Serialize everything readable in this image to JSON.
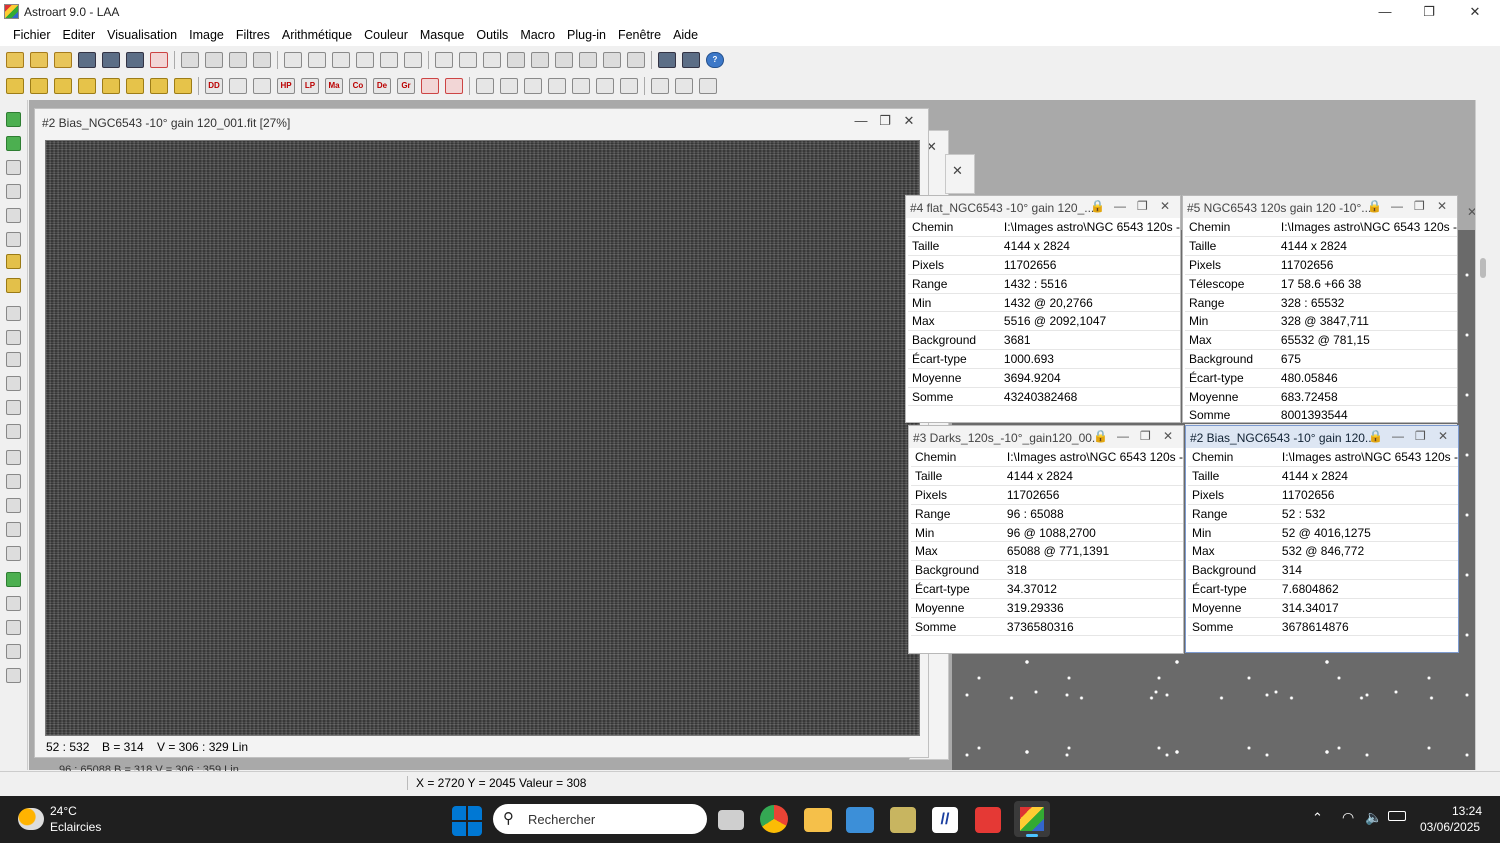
{
  "app": {
    "title": "Astroart 9.0 - LAA"
  },
  "window_controls": {
    "minimize": "—",
    "maximize": "❐",
    "close": "✕"
  },
  "menu": [
    "Fichier",
    "Editer",
    "Visualisation",
    "Image",
    "Filtres",
    "Arithmétique",
    "Couleur",
    "Masque",
    "Outils",
    "Macro",
    "Plug-in",
    "Fenêtre",
    "Aide"
  ],
  "toolbar2_labels": {
    "dd": "DD",
    "hp": "HP",
    "lp": "LP",
    "ma": "Ma",
    "co": "Co",
    "de": "De",
    "gr": "Gr"
  },
  "image_window": {
    "title": "#2 Bias_NGC6543 -10° gain 120_001.fit  [27%]",
    "status_range": "52 : 532",
    "status_b": "B = 314",
    "status_v": "V = 306 : 329 Lin"
  },
  "underlying_status": "96 : 65088     B = 318     V = 306 : 359 Lin",
  "info_windows": [
    {
      "title": "#4 flat_NGC6543 -10° gain 120_...",
      "rows": [
        [
          "Chemin",
          "I:\\Images astro\\NGC 6543 120s -"
        ],
        [
          "Taille",
          "4144 x 2824"
        ],
        [
          "Pixels",
          "11702656"
        ],
        [
          "Range",
          "1432 : 5516"
        ],
        [
          "Min",
          "1432 @ 20,2766"
        ],
        [
          "Max",
          "5516 @ 2092,1047"
        ],
        [
          "Background",
          "3681"
        ],
        [
          "Écart-type",
          "1000.693"
        ],
        [
          "Moyenne",
          "3694.9204"
        ],
        [
          "Somme",
          "43240382468"
        ]
      ]
    },
    {
      "title": "#5 NGC6543 120s gain 120 -10°...",
      "rows": [
        [
          "Chemin",
          "I:\\Images astro\\NGC 6543 120s -"
        ],
        [
          "Taille",
          "4144 x 2824"
        ],
        [
          "Pixels",
          "11702656"
        ],
        [
          "Télescope",
          "17 58.6  +66 38"
        ],
        [
          "Range",
          "328 : 65532"
        ],
        [
          "Min",
          "328 @ 3847,711"
        ],
        [
          "Max",
          "65532 @ 781,15"
        ],
        [
          "Background",
          "675"
        ],
        [
          "Écart-type",
          "480.05846"
        ],
        [
          "Moyenne",
          "683.72458"
        ],
        [
          "Somme",
          "8001393544"
        ]
      ]
    },
    {
      "title": "#3 Darks_120s_-10°_gain120_00...",
      "rows": [
        [
          "Chemin",
          "I:\\Images astro\\NGC 6543 120s -"
        ],
        [
          "Taille",
          "4144 x 2824"
        ],
        [
          "Pixels",
          "11702656"
        ],
        [
          "Range",
          "96 : 65088"
        ],
        [
          "Min",
          "96 @ 1088,2700"
        ],
        [
          "Max",
          "65088 @ 771,1391"
        ],
        [
          "Background",
          "318"
        ],
        [
          "Écart-type",
          "34.37012"
        ],
        [
          "Moyenne",
          "319.29336"
        ],
        [
          "Somme",
          "3736580316"
        ]
      ]
    },
    {
      "title": "#2 Bias_NGC6543 -10° gain 120...",
      "rows": [
        [
          "Chemin",
          "I:\\Images astro\\NGC 6543 120s -"
        ],
        [
          "Taille",
          "4144 x 2824"
        ],
        [
          "Pixels",
          "11702656"
        ],
        [
          "Range",
          "52 : 532"
        ],
        [
          "Min",
          "52 @ 4016,1275"
        ],
        [
          "Max",
          "532 @ 846,772"
        ],
        [
          "Background",
          "314"
        ],
        [
          "Écart-type",
          "7.6804862"
        ],
        [
          "Moyenne",
          "314.34017"
        ],
        [
          "Somme",
          "3678614876"
        ]
      ]
    }
  ],
  "statusbar": {
    "coords": "X = 2720  Y = 2045  Valeur = 308"
  },
  "taskbar": {
    "temp": "24°C",
    "weather": "Eclaircies",
    "search_placeholder": "Rechercher",
    "time": "13:24",
    "date": "03/06/2025"
  },
  "colors": {
    "accent": "#0078d4",
    "taskbar": "#1f1f1f",
    "active_border": "#7d9bd0"
  }
}
